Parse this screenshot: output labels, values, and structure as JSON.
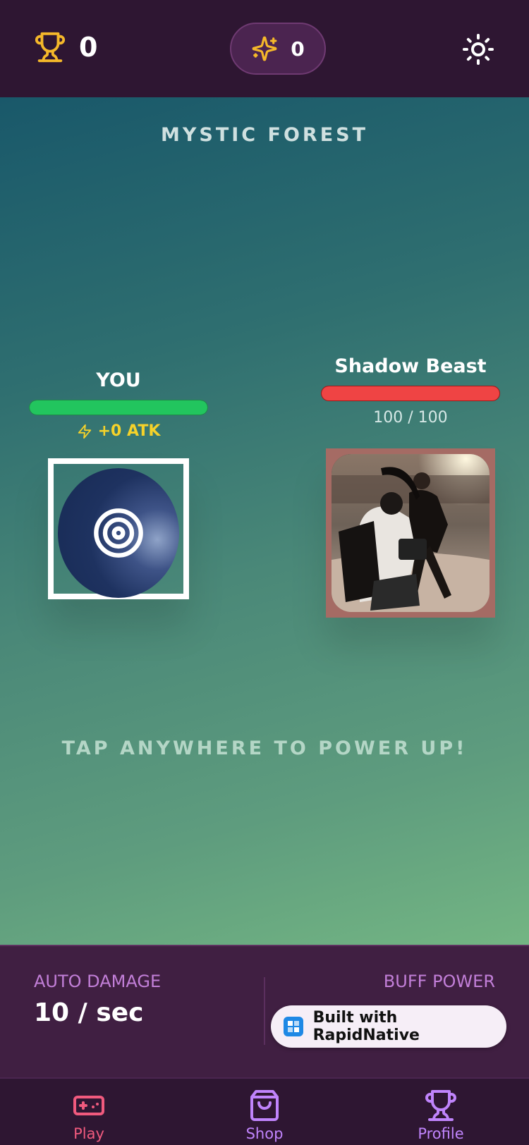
{
  "header": {
    "trophy_count": "0",
    "gem_count": "0"
  },
  "arena": {
    "title": "MYSTIC FOREST",
    "tap_hint": "TAP ANYWHERE TO POWER UP!"
  },
  "player": {
    "name": "YOU",
    "hp_fraction": 1.0,
    "atk_label": "+0 ATK"
  },
  "enemy": {
    "name": "Shadow Beast",
    "hp_fraction": 1.0,
    "hp_text": "100 / 100"
  },
  "stats": {
    "auto_damage_label": "AUTO DAMAGE",
    "auto_damage_value": "10 / sec",
    "buff_power_label": "BUFF POWER"
  },
  "badge": {
    "text": "Built with RapidNative"
  },
  "nav": {
    "items": [
      {
        "label": "Play",
        "icon": "gamepad-icon",
        "color": "#f05a7e"
      },
      {
        "label": "Shop",
        "icon": "shopping-bag-icon",
        "color": "#c084fc"
      },
      {
        "label": "Profile",
        "icon": "trophy-icon",
        "color": "#c084fc"
      }
    ]
  },
  "colors": {
    "accent_gold": "#f5b82a",
    "player_hp": "#22c55e",
    "enemy_hp": "#ef4444",
    "stat_label": "#c27fd8"
  }
}
